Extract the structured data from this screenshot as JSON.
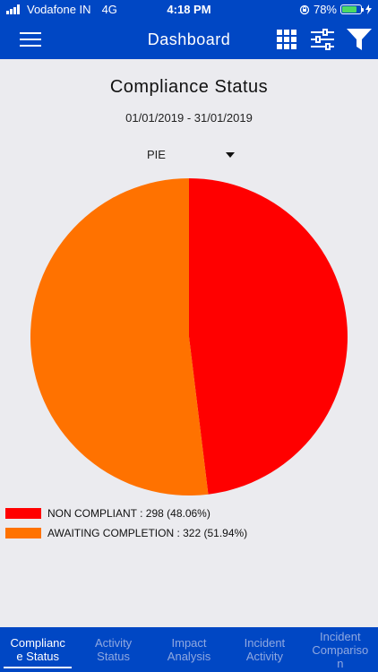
{
  "status_bar": {
    "carrier": "Vodafone IN",
    "network": "4G",
    "time": "4:18 PM",
    "battery": "78%",
    "battery_level": 0.78
  },
  "nav": {
    "title": "Dashboard",
    "icons": [
      "menu-icon",
      "grid-icon",
      "sliders-icon",
      "filter-icon"
    ]
  },
  "report": {
    "title": "Compliance Status",
    "date_range": "01/01/2019 - 31/01/2019",
    "chart_type_selected": "PIE"
  },
  "chart_data": {
    "type": "pie",
    "categories": [
      "NON COMPLIANT",
      "AWAITING COMPLETION"
    ],
    "values": [
      298,
      322
    ],
    "percentages": [
      48.06,
      51.94
    ],
    "colors": [
      "#ff0000",
      "#ff7200"
    ],
    "legend_labels": [
      "NON COMPLIANT : 298 (48.06%)",
      "AWAITING COMPLETION : 322 (51.94%)"
    ],
    "legend_position": "bottom-left"
  },
  "tabs": [
    {
      "label": "Complianc\ne Status",
      "active": true
    },
    {
      "label": "Activity\nStatus",
      "active": false
    },
    {
      "label": "Impact\nAnalysis",
      "active": false
    },
    {
      "label": "Incident\nActivity",
      "active": false
    },
    {
      "label": "Incident\nCompariso\nn",
      "active": false
    }
  ]
}
